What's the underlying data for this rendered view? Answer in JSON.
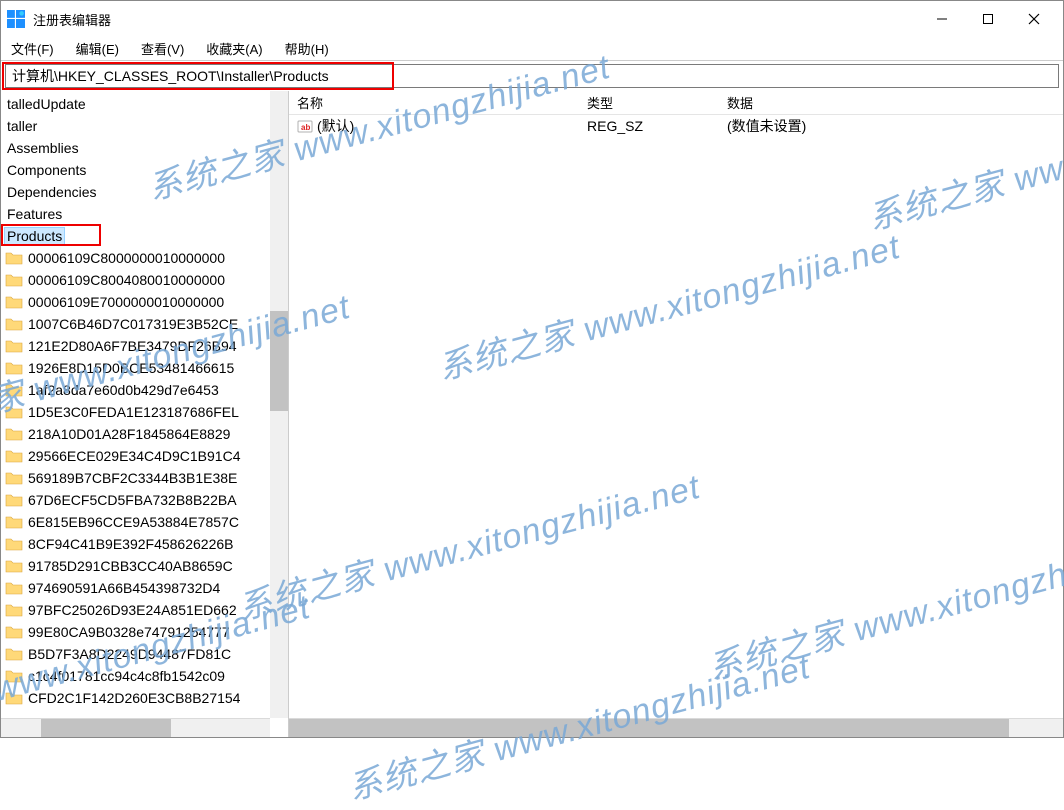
{
  "window": {
    "title": "注册表编辑器"
  },
  "menu": {
    "file": "文件(F)",
    "edit": "编辑(E)",
    "view": "查看(V)",
    "fav": "收藏夹(A)",
    "help": "帮助(H)"
  },
  "address": "计算机\\HKEY_CLASSES_ROOT\\Installer\\Products",
  "tree": {
    "top_items": [
      {
        "label": "talledUpdate",
        "icon": false
      },
      {
        "label": "taller",
        "icon": false
      },
      {
        "label": "Assemblies",
        "icon": false
      },
      {
        "label": "Components",
        "icon": false
      },
      {
        "label": "Dependencies",
        "icon": false
      },
      {
        "label": "Features",
        "icon": false
      },
      {
        "label": "Products",
        "icon": false,
        "highlighted": true
      }
    ],
    "product_items": [
      "00006109C8000000010000000",
      "00006109C8004080010000000",
      "00006109E7000000010000000",
      "1007C6B46D7C017319E3B52CE",
      "121E2D80A6F7BE3479DF26B94",
      "1926E8D15D0BCE53481466615",
      "1af2a8da7e60d0b429d7e6453",
      "1D5E3C0FEDA1E123187686FEL",
      "218A10D01A28F1845864E8829",
      "29566ECE029E34C4D9C1B91C4",
      "569189B7CBF2C3344B3B1E38E",
      "67D6ECF5CD5FBA732B8B22BA",
      "6E815EB96CCE9A53884E7857C",
      "8CF94C41B9E392F458626226B",
      "91785D291CBB3CC40AB8659C",
      "974690591A66B454398732D4",
      "97BFC25026D93E24A851ED662",
      "99E80CA9B0328e74791254777",
      "B5D7F3A8D2249D94487FD81C",
      "c1c4f01781cc94c4c8fb1542c09",
      "CFD2C1F142D260E3CB8B27154"
    ]
  },
  "list": {
    "headers": {
      "name": "名称",
      "type": "类型",
      "data": "数据"
    },
    "rows": [
      {
        "name": "(默认)",
        "type": "REG_SZ",
        "data": "(数值未设置)"
      }
    ]
  },
  "watermark": "系统之家 www.xitongzhijia.net"
}
